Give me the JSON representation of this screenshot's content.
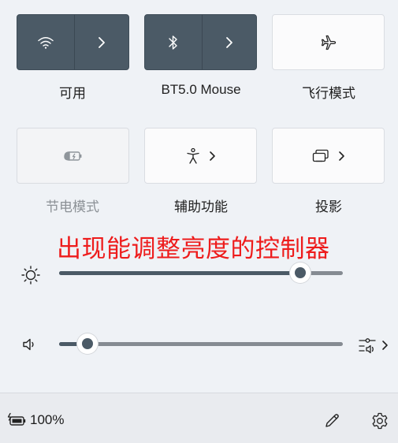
{
  "tiles": [
    {
      "label": "可用",
      "icon": "wifi-icon",
      "state": "on",
      "has_chevron": true
    },
    {
      "label": "BT5.0 Mouse",
      "icon": "bluetooth-icon",
      "state": "on",
      "has_chevron": true
    },
    {
      "label": "飞行模式",
      "icon": "airplane-icon",
      "state": "off",
      "has_chevron": false
    },
    {
      "label": "节电模式",
      "icon": "battery-saver-icon",
      "state": "disabled",
      "has_chevron": false
    },
    {
      "label": "辅助功能",
      "icon": "accessibility-icon",
      "state": "off",
      "has_chevron": true
    },
    {
      "label": "投影",
      "icon": "project-icon",
      "state": "off",
      "has_chevron": true
    }
  ],
  "annotation": "出现能调整亮度的控制器",
  "sliders": {
    "brightness": {
      "icon": "sun-icon",
      "value_fraction": 0.85
    },
    "volume": {
      "icon": "speaker-icon",
      "value_fraction": 0.1,
      "extra_icon": "audio-output-icon"
    }
  },
  "footer": {
    "battery_icon": "battery-charging-icon",
    "battery_percent": "100%",
    "edit_icon": "pencil-icon",
    "settings_icon": "gear-icon"
  },
  "colors": {
    "accent": "#4b5a66",
    "background": "#eff2f6",
    "annotation": "#ee1c1c"
  }
}
